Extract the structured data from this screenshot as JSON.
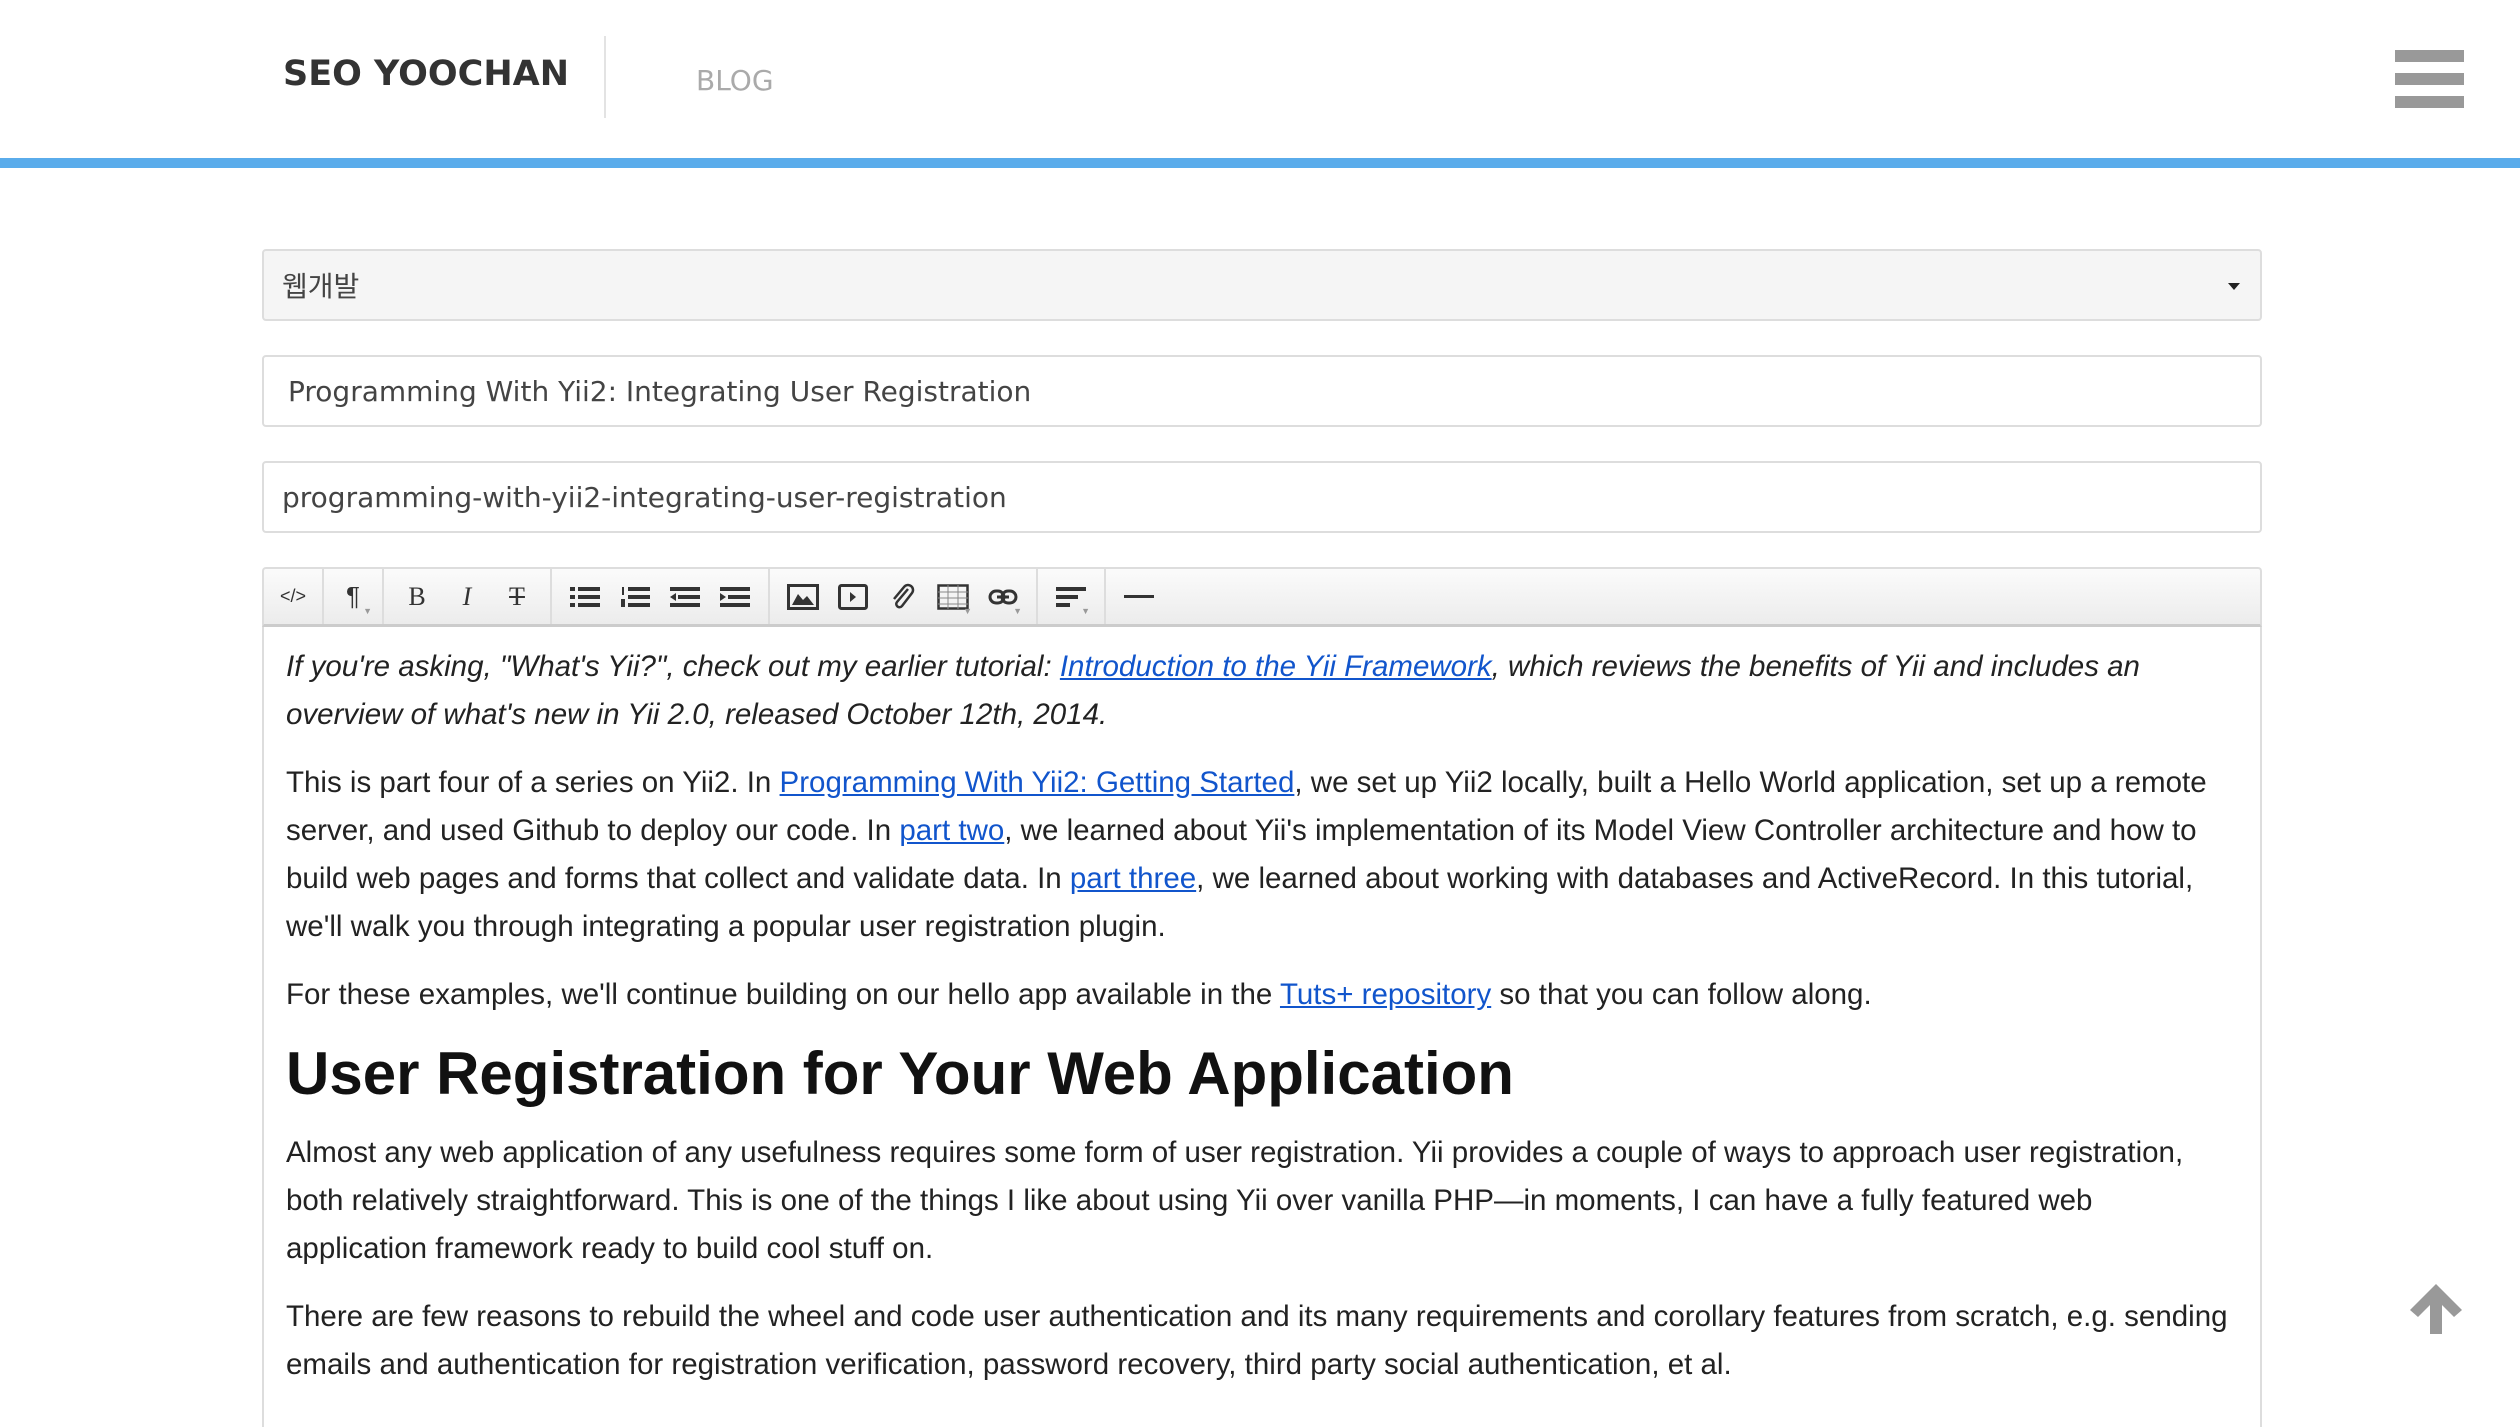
{
  "header": {
    "logo": "SEO YOOCHAN",
    "nav_blog": "BLOG"
  },
  "form": {
    "category": "웹개발",
    "title": "Programming With Yii2: Integrating User Registration",
    "slug": "programming-with-yii2-integrating-user-registration"
  },
  "toolbar": {
    "html": "</>",
    "format": "¶",
    "bold": "B",
    "italic": "I",
    "strike": "T"
  },
  "content": {
    "p1": [
      "If you're asking, \"What's Yii?\", check out my earlier tutorial: ",
      "Introduction to the Yii Framework",
      ", which reviews the benefits of Yii and includes an overview of what's new in Yii 2.0, released October 12th, 2014."
    ],
    "p2": [
      "This is part four of a series on Yii2. In ",
      "Programming With Yii2: Getting Started",
      ", we set up Yii2 locally, built a Hello World application, set up a remote server, and used Github to deploy our code. In ",
      "part two",
      ", we learned about Yii's implementation of its Model View Controller architecture and how to build web pages and forms that collect and validate data. In ",
      "part three",
      ", we learned about working with databases and ActiveRecord. In this tutorial, we'll walk you through integrating a popular user registration plugin."
    ],
    "p3": [
      "For these examples, we'll continue building on our hello app available in the ",
      "Tuts+ repository",
      " so that you can follow along."
    ],
    "h2": "User Registration for Your Web Application",
    "p4": "Almost any web application of any usefulness requires some form of user registration. Yii provides a couple of ways to approach user registration, both relatively straightforward. This is one of the things I like about using Yii over vanilla PHP—in moments, I can have a fully featured web application framework ready to build cool stuff on.",
    "p5": "There are few reasons to rebuild the wheel and code user authentication and its many requirements and corollary features from scratch, e.g. sending emails and authentication for registration verification, password recovery, third party social authentication, et al."
  },
  "colors": {
    "accent": "#5aaceb",
    "link": "#1155cc"
  }
}
